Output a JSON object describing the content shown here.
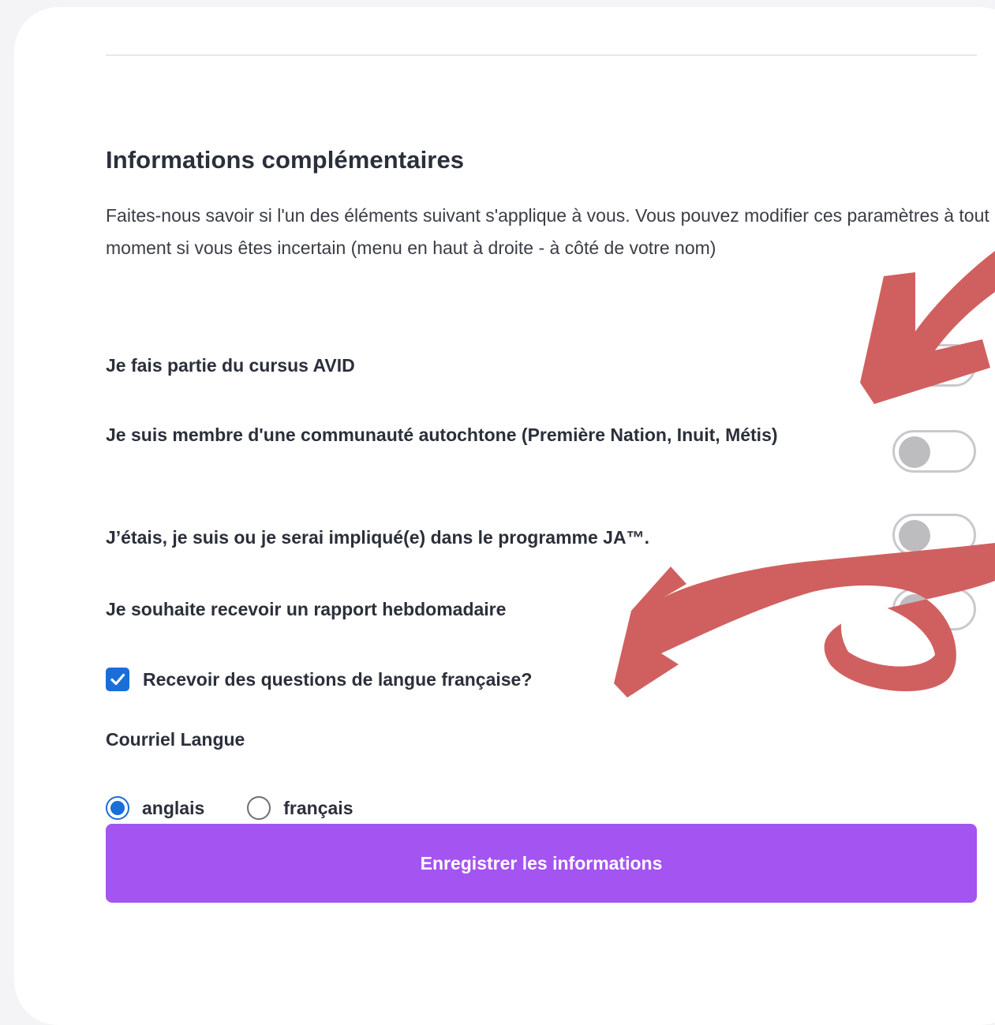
{
  "section": {
    "title": "Informations complémentaires",
    "description": "Faites-nous savoir si l'un des éléments suivant s'applique à vous. Vous pouvez modifier ces paramètres à tout moment si vous êtes incertain (menu en haut à droite - à côté de votre nom)"
  },
  "options": [
    {
      "label": "Je fais partie du cursus AVID",
      "enabled": false
    },
    {
      "label": "Je suis membre d'une communauté autochtone (Première Nation, Inuit, Métis)",
      "enabled": false
    },
    {
      "label": "J’étais, je suis ou je serai impliqué(e) dans le programme JA™.",
      "enabled": false
    },
    {
      "label": "Je souhaite recevoir un rapport hebdomadaire",
      "enabled": false
    }
  ],
  "french_questions": {
    "label": "Recevoir des questions de langue française?",
    "checked": true
  },
  "email_language": {
    "label": "Courriel Langue",
    "options": [
      {
        "label": "anglais",
        "selected": true
      },
      {
        "label": "français",
        "selected": false
      }
    ]
  },
  "save_button": {
    "label": "Enregistrer les informations"
  },
  "colors": {
    "accent": "#a454f0",
    "control_blue": "#1a6ed8",
    "annotation_arrow": "#d06060",
    "toggle_off": "#bdbdc0"
  },
  "icons": [
    "checkmark-icon",
    "curved-arrow-annotation"
  ]
}
